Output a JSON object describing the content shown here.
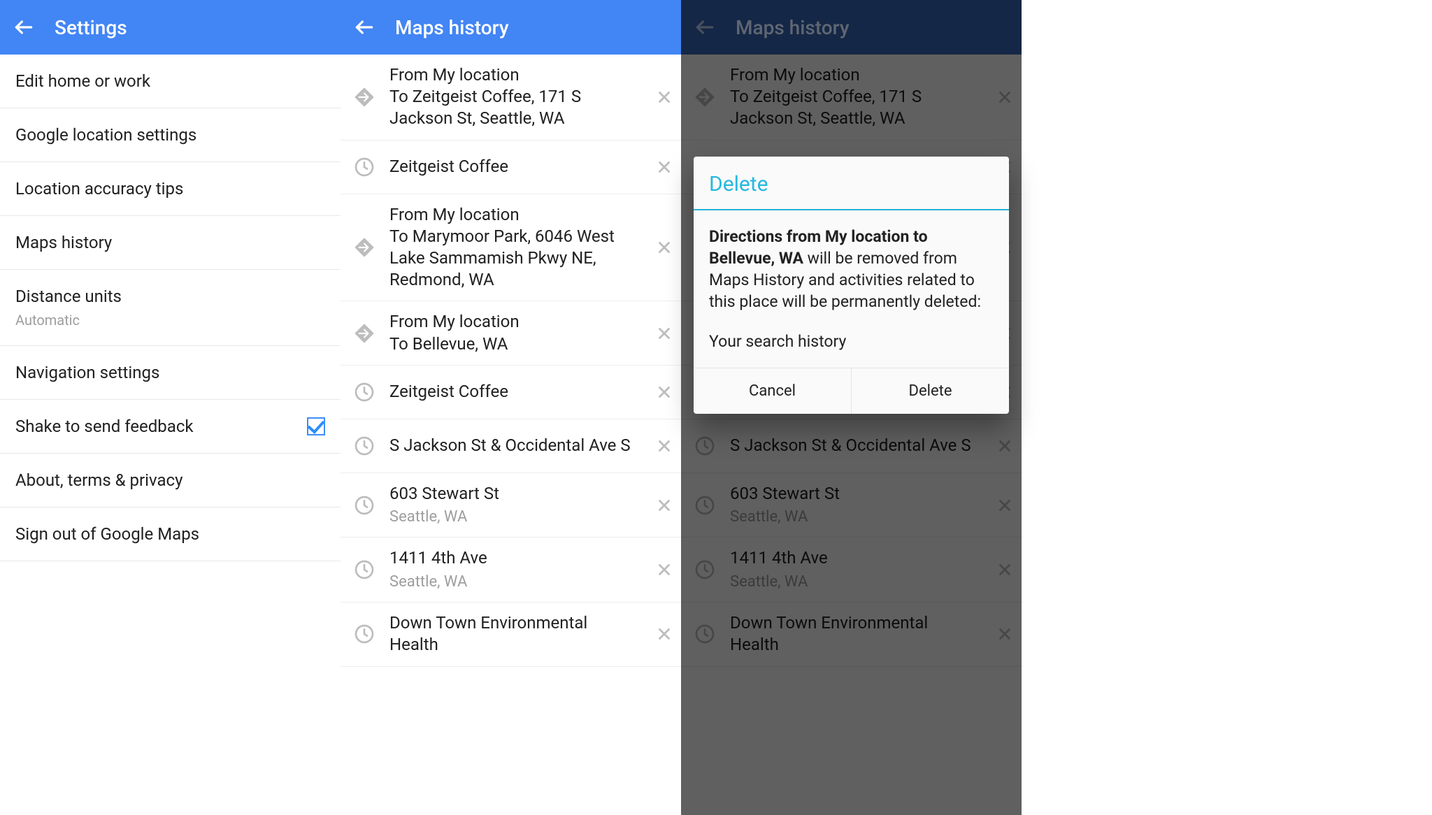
{
  "colors": {
    "primary": "#4285f4",
    "accent": "#26b8e0"
  },
  "pane1": {
    "title": "Settings",
    "items": [
      {
        "label": "Edit home or work"
      },
      {
        "label": "Google location settings"
      },
      {
        "label": "Location accuracy tips"
      },
      {
        "label": "Maps history"
      },
      {
        "label": "Distance units",
        "sub": "Automatic"
      },
      {
        "label": "Navigation settings"
      },
      {
        "label": "Shake to send feedback",
        "checked": true
      },
      {
        "label": "About, terms & privacy"
      },
      {
        "label": "Sign out of Google Maps"
      }
    ]
  },
  "pane2": {
    "title": "Maps history",
    "items": [
      {
        "icon": "directions",
        "line1": "From My location\nTo Zeitgeist Coffee, 171 S Jackson St, Seattle, WA"
      },
      {
        "icon": "clock",
        "line1": "Zeitgeist Coffee"
      },
      {
        "icon": "directions",
        "line1": "From My location\nTo Marymoor Park, 6046 West Lake Sammamish Pkwy NE, Redmond, WA"
      },
      {
        "icon": "directions",
        "line1": "From My location\nTo Bellevue, WA"
      },
      {
        "icon": "clock",
        "line1": "Zeitgeist Coffee"
      },
      {
        "icon": "clock",
        "line1": "S Jackson St & Occidental Ave S"
      },
      {
        "icon": "clock",
        "line1": "603 Stewart St",
        "line2": "Seattle, WA"
      },
      {
        "icon": "clock",
        "line1": "1411 4th Ave",
        "line2": "Seattle, WA"
      },
      {
        "icon": "clock",
        "line1": "Down Town Environmental Health"
      }
    ]
  },
  "pane3": {
    "title": "Maps history",
    "dialog": {
      "title": "Delete",
      "bold_part": "Directions from My location to Bellevue, WA",
      "rest_part": " will be removed from Maps History and activities related to this place will be permanently deleted:",
      "sub": "Your search history",
      "cancel": "Cancel",
      "confirm": "Delete"
    }
  }
}
